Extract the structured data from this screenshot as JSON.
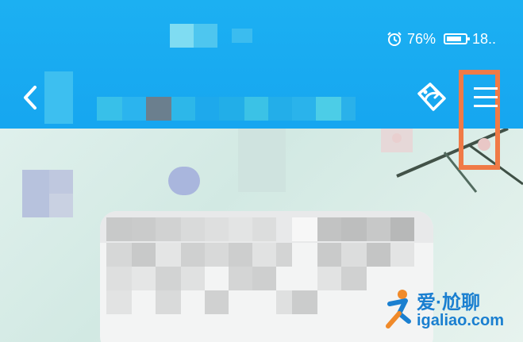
{
  "status_bar": {
    "battery_percent": "76%",
    "time": "18..",
    "alarm_icon": "alarm-clock-icon",
    "battery_icon": "battery-icon"
  },
  "nav": {
    "back_icon": "chevron-left-icon",
    "share_icon": "share-icon",
    "menu_icon": "hamburger-menu-icon"
  },
  "highlight": {
    "color": "#f07a46",
    "target": "menu-button"
  },
  "colors": {
    "header_blue": "#16a6f0",
    "content_bg": "#dfeee9"
  },
  "watermark": {
    "top_text": "爱·尬聊",
    "bottom_text": "igaliao.com"
  }
}
